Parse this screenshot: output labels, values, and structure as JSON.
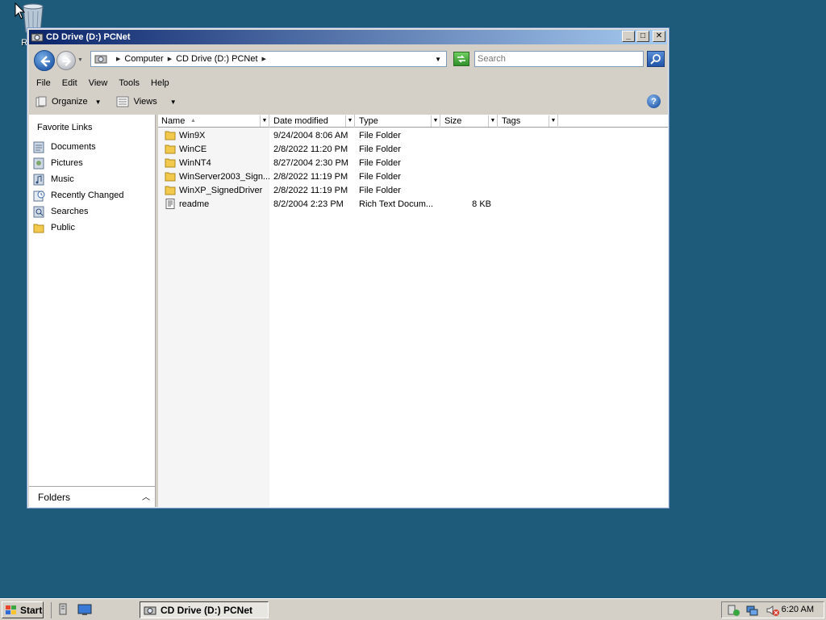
{
  "desktop": {
    "recycle_label": "Rec"
  },
  "window": {
    "title": "CD Drive (D:) PCNet",
    "address": {
      "crumbs": [
        "Computer",
        "CD Drive (D:) PCNet"
      ]
    },
    "search_placeholder": "Search",
    "menu": [
      "File",
      "Edit",
      "View",
      "Tools",
      "Help"
    ],
    "toolbar": {
      "organize": "Organize",
      "views": "Views"
    },
    "navpane": {
      "header": "Favorite Links",
      "links": [
        "Documents",
        "Pictures",
        "Music",
        "Recently Changed",
        "Searches",
        "Public"
      ],
      "folders": "Folders"
    },
    "columns": {
      "name": "Name",
      "date": "Date modified",
      "type": "Type",
      "size": "Size",
      "tags": "Tags"
    },
    "files": [
      {
        "name": "Win9X",
        "date": "9/24/2004 8:06 AM",
        "type": "File Folder",
        "size": ""
      },
      {
        "name": "WinCE",
        "date": "2/8/2022 11:20 PM",
        "type": "File Folder",
        "size": ""
      },
      {
        "name": "WinNT4",
        "date": "8/27/2004 2:30 PM",
        "type": "File Folder",
        "size": ""
      },
      {
        "name": "WinServer2003_Sign...",
        "date": "2/8/2022 11:19 PM",
        "type": "File Folder",
        "size": ""
      },
      {
        "name": "WinXP_SignedDriver",
        "date": "2/8/2022 11:19 PM",
        "type": "File Folder",
        "size": ""
      },
      {
        "name": "readme",
        "date": "8/2/2004 2:23 PM",
        "type": "Rich Text Docum...",
        "size": "8 KB"
      }
    ]
  },
  "taskbar": {
    "start": "Start",
    "task": "CD Drive (D:) PCNet",
    "clock": "6:20 AM"
  }
}
